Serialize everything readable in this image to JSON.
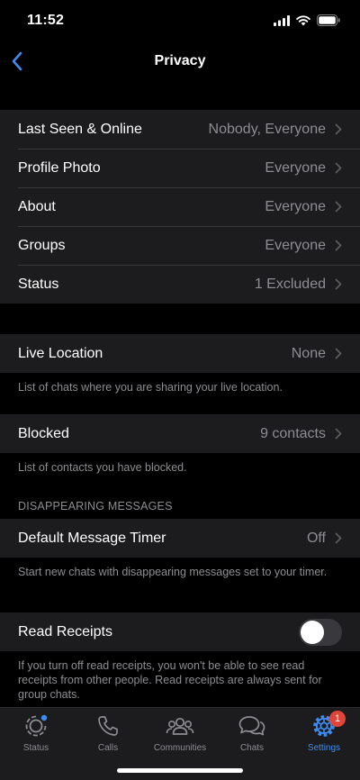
{
  "status_bar": {
    "time": "11:52"
  },
  "nav": {
    "title": "Privacy"
  },
  "privacy_rows": [
    {
      "label": "Last Seen & Online",
      "value": "Nobody, Everyone"
    },
    {
      "label": "Profile Photo",
      "value": "Everyone"
    },
    {
      "label": "About",
      "value": "Everyone"
    },
    {
      "label": "Groups",
      "value": "Everyone"
    },
    {
      "label": "Status",
      "value": "1 Excluded"
    }
  ],
  "live_location": {
    "label": "Live Location",
    "value": "None",
    "footnote": "List of chats where you are sharing your live location."
  },
  "blocked": {
    "label": "Blocked",
    "value": "9 contacts",
    "footnote": "List of contacts you have blocked."
  },
  "disappearing": {
    "header": "DISAPPEARING MESSAGES",
    "label": "Default Message Timer",
    "value": "Off",
    "footnote": "Start new chats with disappearing messages set to your timer."
  },
  "read_receipts": {
    "label": "Read Receipts",
    "enabled": false,
    "footnote": "If you turn off read receipts, you won't be able to see read receipts from other people. Read receipts are always sent for group chats."
  },
  "tabs": [
    {
      "label": "Status",
      "icon": "status-icon"
    },
    {
      "label": "Calls",
      "icon": "phone-icon"
    },
    {
      "label": "Communities",
      "icon": "communities-icon"
    },
    {
      "label": "Chats",
      "icon": "chats-icon"
    },
    {
      "label": "Settings",
      "icon": "gear-icon",
      "badge": "1",
      "active": true
    }
  ],
  "colors": {
    "accent": "#3e8cf1",
    "badge": "#e0453a",
    "cell": "#1c1c1e",
    "secondary_text": "#8d8d92"
  }
}
